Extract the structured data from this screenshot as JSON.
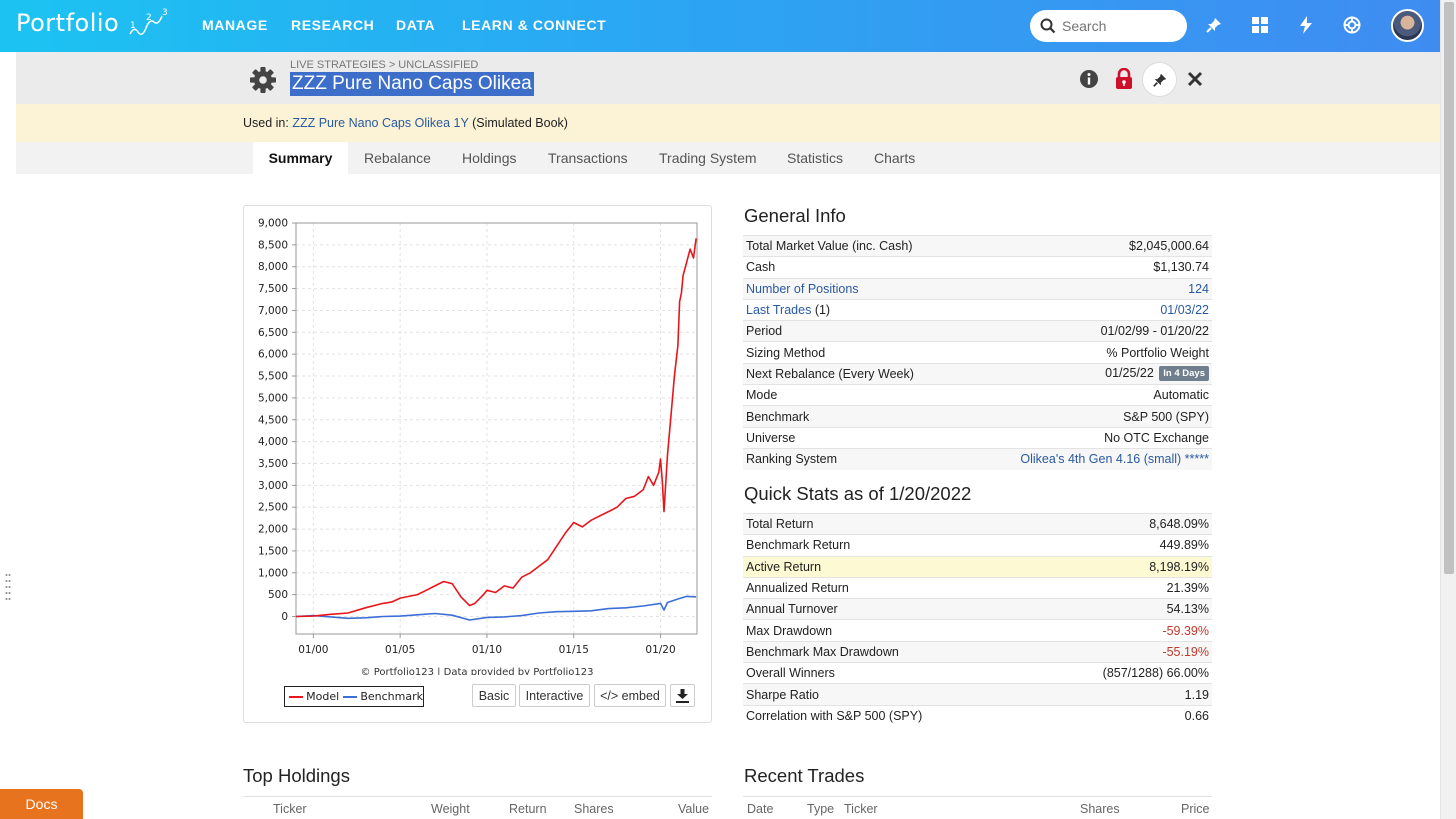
{
  "nav": {
    "logo": "Portfolio",
    "logo_sub": "123",
    "items": [
      "MANAGE",
      "RESEARCH",
      "DATA",
      "LEARN & CONNECT"
    ],
    "search_placeholder": "Search"
  },
  "header": {
    "breadcrumb": "LIVE STRATEGIES > UNCLASSIFIED",
    "title": "ZZZ Pure Nano Caps Olikea"
  },
  "used_in": {
    "prefix": "Used in:",
    "link": "ZZZ Pure Nano Caps Olikea 1Y",
    "suffix": "(Simulated Book)"
  },
  "tabs": [
    "Summary",
    "Rebalance",
    "Holdings",
    "Transactions",
    "Trading System",
    "Statistics",
    "Charts"
  ],
  "active_tab": "Summary",
  "chart_footer": "© Portfolio123 | Data provided by Portfolio123",
  "chart_buttons": {
    "basic": "Basic",
    "interactive": "Interactive",
    "embed": "</> embed"
  },
  "chart_data": {
    "type": "line",
    "title": "",
    "xlabel": "",
    "ylabel": "",
    "ylim": [
      -400,
      9000
    ],
    "yticks": [
      "9,000",
      "8,500",
      "8,000",
      "7,500",
      "7,000",
      "6,500",
      "6,000",
      "5,500",
      "5,000",
      "4,500",
      "4,000",
      "3,500",
      "3,000",
      "2,500",
      "2,000",
      "1,500",
      "1,000",
      "500",
      "0"
    ],
    "ytick_values": [
      9000,
      8500,
      8000,
      7500,
      7000,
      6500,
      6000,
      5500,
      5000,
      4500,
      4000,
      3500,
      3000,
      2500,
      2000,
      1500,
      1000,
      500,
      0
    ],
    "xticks": [
      "01/00",
      "01/05",
      "01/10",
      "01/15",
      "01/20"
    ],
    "xtick_values": [
      2000,
      2005,
      2010,
      2015,
      2020
    ],
    "xlim": [
      1999,
      2022.1
    ],
    "grid": true,
    "legend": "bottom",
    "series": [
      {
        "name": "Model",
        "color": "#e8161b",
        "x": [
          1999.0,
          2000.0,
          2001.0,
          2002.0,
          2003.0,
          2004.0,
          2004.5,
          2005.0,
          2006.0,
          2006.5,
          2007.0,
          2007.5,
          2008.0,
          2008.5,
          2009.0,
          2009.3,
          2009.8,
          2010.0,
          2010.5,
          2011.0,
          2011.5,
          2012.0,
          2012.5,
          2013.0,
          2013.5,
          2014.0,
          2014.5,
          2015.0,
          2015.5,
          2016.0,
          2016.5,
          2017.0,
          2017.5,
          2018.0,
          2018.5,
          2019.0,
          2019.3,
          2019.6,
          2019.9,
          2020.0,
          2020.1,
          2020.2,
          2020.4,
          2020.6,
          2020.8,
          2021.0,
          2021.1,
          2021.2,
          2021.3,
          2021.5,
          2021.7,
          2021.9,
          2022.05
        ],
        "y": [
          0,
          10,
          50,
          80,
          200,
          300,
          330,
          420,
          500,
          600,
          700,
          800,
          750,
          450,
          250,
          300,
          500,
          600,
          550,
          700,
          650,
          900,
          1000,
          1150,
          1300,
          1600,
          1900,
          2150,
          2050,
          2200,
          2300,
          2400,
          2500,
          2700,
          2750,
          2900,
          3200,
          3000,
          3300,
          3600,
          3100,
          2400,
          3700,
          4600,
          5500,
          6200,
          7200,
          7400,
          7800,
          8100,
          8400,
          8200,
          8648
        ]
      },
      {
        "name": "Benchmark",
        "color": "#3b6fd6",
        "x": [
          1999.0,
          2000.0,
          2001.0,
          2002.0,
          2003.0,
          2004.0,
          2005.0,
          2006.0,
          2007.0,
          2008.0,
          2009.0,
          2010.0,
          2011.0,
          2012.0,
          2013.0,
          2014.0,
          2015.0,
          2016.0,
          2017.0,
          2018.0,
          2019.0,
          2020.0,
          2020.2,
          2020.4,
          2021.0,
          2021.5,
          2022.05
        ],
        "y": [
          0,
          20,
          -10,
          -40,
          -30,
          0,
          10,
          40,
          70,
          30,
          -80,
          -20,
          -10,
          20,
          80,
          110,
          120,
          130,
          180,
          200,
          240,
          300,
          150,
          320,
          400,
          460,
          450
        ]
      }
    ]
  },
  "general_info": {
    "title": "General Info",
    "rows": [
      {
        "label": "Total Market Value (inc. Cash)",
        "value": "$2,045,000.64"
      },
      {
        "label": "Cash",
        "value": "$1,130.74"
      },
      {
        "label": "Number of Positions",
        "value": "124"
      },
      {
        "label": "Last Trades",
        "label_suffix": "(1)",
        "value": "01/03/22"
      },
      {
        "label": "Period",
        "value": "01/02/99 - 01/20/22"
      },
      {
        "label": "Sizing Method",
        "value": "% Portfolio Weight"
      },
      {
        "label": "Next Rebalance (Every Week)",
        "value": "01/25/22",
        "badge": "In 4 Days"
      },
      {
        "label": "Mode",
        "value": "Automatic"
      },
      {
        "label": "Benchmark",
        "value": "S&P 500 (SPY)"
      },
      {
        "label": "Universe",
        "value": "No OTC Exchange"
      },
      {
        "label": "Ranking System",
        "value": "Olikea's 4th Gen 4.16 (small) *****"
      }
    ]
  },
  "quick_stats": {
    "title": "Quick Stats as of 1/20/2022",
    "rows": [
      {
        "label": "Total Return",
        "value": "8,648.09%"
      },
      {
        "label": "Benchmark Return",
        "value": "449.89%"
      },
      {
        "label": "Active Return",
        "value": "8,198.19%"
      },
      {
        "label": "Annualized Return",
        "value": "21.39%"
      },
      {
        "label": "Annual Turnover",
        "value": "54.13%"
      },
      {
        "label": "Max Drawdown",
        "value": "-59.39%"
      },
      {
        "label": "Benchmark Max Drawdown",
        "value": "-55.19%"
      },
      {
        "label": "Overall Winners",
        "value": "(857/1288) 66.00%"
      },
      {
        "label": "Sharpe Ratio",
        "value": "1.19"
      },
      {
        "label": "Correlation with S&P 500 (SPY)",
        "value": "0.66"
      }
    ]
  },
  "top_holdings": {
    "title": "Top Holdings",
    "columns": [
      "Ticker",
      "Weight",
      "Return",
      "Shares",
      "Value"
    ]
  },
  "recent_trades": {
    "title": "Recent Trades",
    "columns": [
      "Date",
      "Type",
      "Ticker",
      "Shares",
      "Price"
    ]
  },
  "docs_label": "Docs"
}
